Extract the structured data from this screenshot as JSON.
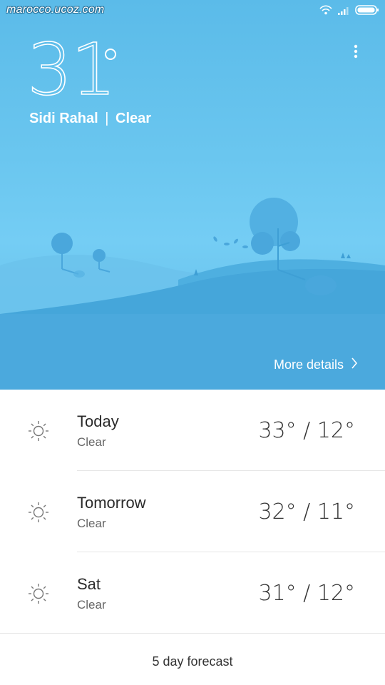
{
  "status_bar": {
    "watermark": "marocco.ucoz.com",
    "icons": [
      "wifi-icon",
      "signal-icon",
      "battery-icon"
    ]
  },
  "current": {
    "temperature": "31",
    "location": "Sidi Rahal",
    "separator": "|",
    "condition": "Clear"
  },
  "more_details": {
    "label": "More details"
  },
  "forecast": {
    "days": [
      {
        "day": "Today",
        "condition": "Clear",
        "temps": "33° / 12°",
        "icon": "sun-icon"
      },
      {
        "day": "Tomorrow",
        "condition": "Clear",
        "temps": "32° / 11°",
        "icon": "sun-icon"
      },
      {
        "day": "Sat",
        "condition": "Clear",
        "temps": "31° / 12°",
        "icon": "sun-icon"
      }
    ],
    "five_day_label": "5 day forecast"
  },
  "colors": {
    "sky_top": "#5bbbe9",
    "sky_mid": "#74cdf4",
    "hill_light": "#63bde9",
    "hill_dark": "#4aa9dc",
    "text_dark": "#2b2b2b",
    "text_muted": "#666666"
  }
}
